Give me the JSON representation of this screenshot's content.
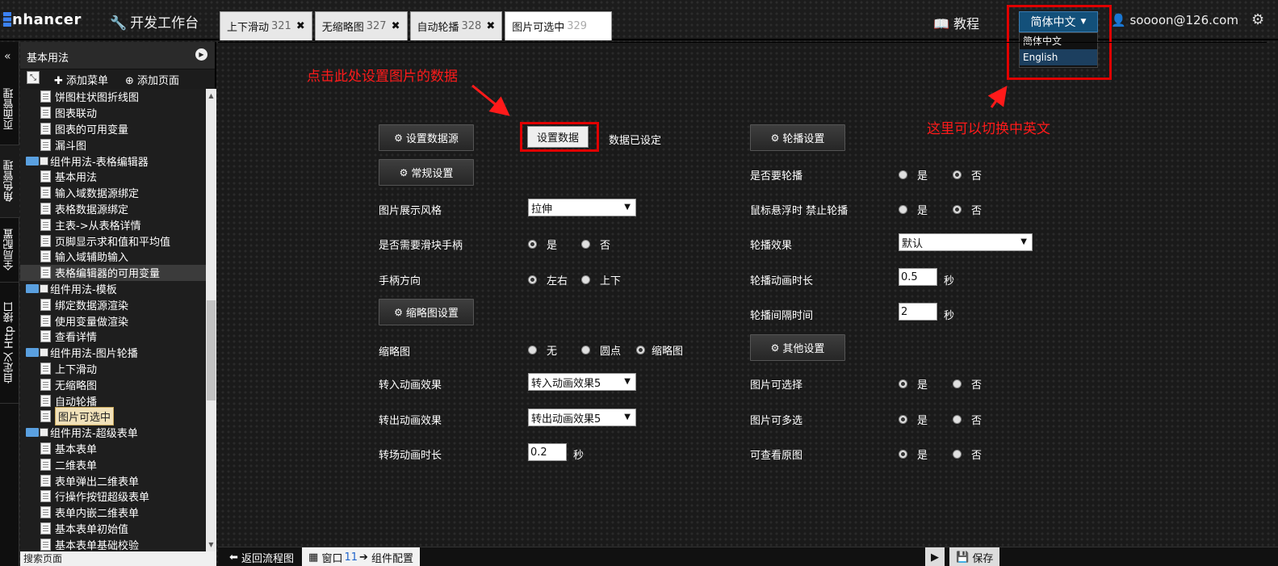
{
  "topbar": {
    "logo": "nhancer",
    "devbench": "开发工作台",
    "tabs": [
      {
        "label": "上下滑动",
        "num": "321"
      },
      {
        "label": "无缩略图",
        "num": "327"
      },
      {
        "label": "自动轮播",
        "num": "328"
      },
      {
        "label": "图片可选中",
        "num": "329"
      }
    ],
    "tutorial": "教程",
    "language": {
      "current": "简体中文",
      "options": [
        "简体中文",
        "English"
      ]
    },
    "user": "soooon@126.com"
  },
  "rail": {
    "items": [
      "页面管理",
      "角色管理",
      "全局配置",
      "自定义 Http 接口"
    ]
  },
  "sidebar": {
    "title": "基本用法",
    "add_menu": "添加菜单",
    "add_page": "添加页面",
    "tree": [
      {
        "t": "leaf",
        "label": "饼图柱状图折线图"
      },
      {
        "t": "leaf",
        "label": "图表联动"
      },
      {
        "t": "leaf",
        "label": "图表的可用变量"
      },
      {
        "t": "leaf",
        "label": "漏斗图"
      },
      {
        "t": "folder",
        "label": "组件用法-表格编辑器"
      },
      {
        "t": "leaf",
        "label": "基本用法"
      },
      {
        "t": "leaf",
        "label": "输入域数据源绑定"
      },
      {
        "t": "leaf",
        "label": "表格数据源绑定"
      },
      {
        "t": "leaf",
        "label": "主表->从表格详情"
      },
      {
        "t": "leaf",
        "label": "页脚显示求和值和平均值"
      },
      {
        "t": "leaf",
        "label": "输入域辅助输入"
      },
      {
        "t": "leaf",
        "label": "表格编辑器的可用变量",
        "hl": true
      },
      {
        "t": "folder",
        "label": "组件用法-模板"
      },
      {
        "t": "leaf",
        "label": "绑定数据源渲染"
      },
      {
        "t": "leaf",
        "label": "使用变量做渲染"
      },
      {
        "t": "leaf",
        "label": "查看详情"
      },
      {
        "t": "folder",
        "label": "组件用法-图片轮播"
      },
      {
        "t": "leaf",
        "label": "上下滑动"
      },
      {
        "t": "leaf",
        "label": "无缩略图"
      },
      {
        "t": "leaf",
        "label": "自动轮播"
      },
      {
        "t": "leaf",
        "label": "图片可选中",
        "selected": true
      },
      {
        "t": "folder",
        "label": "组件用法-超级表单"
      },
      {
        "t": "leaf",
        "label": "基本表单"
      },
      {
        "t": "leaf",
        "label": "二维表单"
      },
      {
        "t": "leaf",
        "label": "表单弹出二维表单"
      },
      {
        "t": "leaf",
        "label": "行操作按钮超级表单"
      },
      {
        "t": "leaf",
        "label": "表单内嵌二维表单"
      },
      {
        "t": "leaf",
        "label": "基本表单初始值"
      },
      {
        "t": "leaf",
        "label": "基本表单基础校验"
      }
    ],
    "bottom": "搜索页面"
  },
  "annotations": {
    "set_data_hint": "点击此处设置图片的数据",
    "lang_hint": "这里可以切换中英文"
  },
  "left": {
    "datasource_btn": "设置数据源",
    "set_data_btn": "设置数据",
    "data_status": "数据已设定",
    "general_btn": "常规设置",
    "display_style_label": "图片展示风格",
    "display_style_value": "拉伸",
    "slider_handle_label": "是否需要滑块手柄",
    "handle_dir_label": "手柄方向",
    "thumb_btn": "缩略图设置",
    "thumb_label": "缩略图",
    "enter_anim_label": "转入动画效果",
    "enter_anim_value": "转入动画效果5",
    "exit_anim_label": "转出动画效果",
    "exit_anim_value": "转出动画效果5",
    "trans_dur_label": "转场动画时长",
    "trans_dur_value": "0.2",
    "sec": "秒"
  },
  "right": {
    "carousel_btn": "轮播设置",
    "autoplay_label": "是否要轮播",
    "hover_label": "鼠标悬浮时 禁止轮播",
    "effect_label": "轮播效果",
    "effect_value": "默认",
    "anim_dur_label": "轮播动画时长",
    "anim_dur_value": "0.5",
    "interval_label": "轮播间隔时间",
    "interval_value": "2",
    "other_btn": "其他设置",
    "selectable_label": "图片可选择",
    "multi_label": "图片可多选",
    "view_orig_label": "可查看原图",
    "sec": "秒"
  },
  "options": {
    "yes": "是",
    "no": "否",
    "lr": "左右",
    "ud": "上下",
    "none": "无",
    "dot": "圆点",
    "thumb": "缩略图"
  },
  "bottombar": {
    "back": "返回流程图",
    "window_prefix": "窗口",
    "window_num": "11",
    "window_suffix": "组件配置",
    "save": "保存"
  }
}
